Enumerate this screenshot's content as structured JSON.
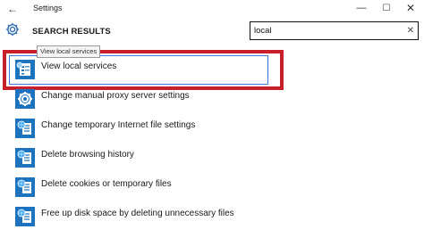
{
  "window": {
    "title": "Settings",
    "back_glyph": "←",
    "minimize_glyph": "—",
    "maximize_glyph": "☐",
    "close_glyph": "✕"
  },
  "header": {
    "title": "SEARCH RESULTS",
    "icon": "gear-icon"
  },
  "search": {
    "value": "local",
    "clear_glyph": "✕"
  },
  "tooltip": {
    "text": "View local services"
  },
  "results": [
    {
      "label": "View local services",
      "icon": "services-icon",
      "selected": true
    },
    {
      "label": "Change manual proxy server settings",
      "icon": "gear-icon",
      "selected": false
    },
    {
      "label": "Change temporary Internet file settings",
      "icon": "internet-options-icon",
      "selected": false
    },
    {
      "label": "Delete browsing history",
      "icon": "internet-options-icon",
      "selected": false
    },
    {
      "label": "Delete cookies or temporary files",
      "icon": "internet-options-icon",
      "selected": false
    },
    {
      "label": "Free up disk space by deleting unnecessary files",
      "icon": "internet-options-icon",
      "selected": false
    }
  ],
  "colors": {
    "accent": "#1e73be",
    "highlight_border": "#c91e2b",
    "selection_border": "#3c78d6"
  }
}
